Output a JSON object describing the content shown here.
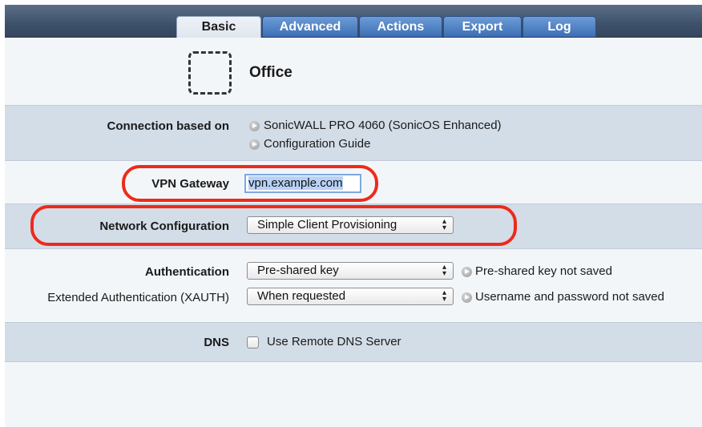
{
  "tabs": [
    {
      "label": "Basic",
      "active": true
    },
    {
      "label": "Advanced",
      "active": false
    },
    {
      "label": "Actions",
      "active": false
    },
    {
      "label": "Export",
      "active": false
    },
    {
      "label": "Log",
      "active": false
    }
  ],
  "header": {
    "name": "Office",
    "icon": "dashed-placeholder-icon"
  },
  "connection": {
    "label": "Connection based on",
    "device": "SonicWALL PRO 4060 (SonicOS Enhanced)",
    "guide": "Configuration Guide"
  },
  "gateway": {
    "label": "VPN Gateway",
    "value": "vpn.example.com"
  },
  "network": {
    "label": "Network Configuration",
    "value": "Simple Client Provisioning"
  },
  "auth": {
    "label": "Authentication",
    "value": "Pre-shared key",
    "status": "Pre-shared key not saved"
  },
  "xauth": {
    "label": "Extended Authentication (XAUTH)",
    "value": "When requested",
    "status": "Username and password not saved"
  },
  "dns": {
    "label": "DNS",
    "checkbox_label": "Use Remote DNS Server",
    "checked": false
  },
  "colors": {
    "highlight": "#ee2a1a",
    "tab_blue": "#3c6eb4",
    "band": "#d3dde8"
  }
}
